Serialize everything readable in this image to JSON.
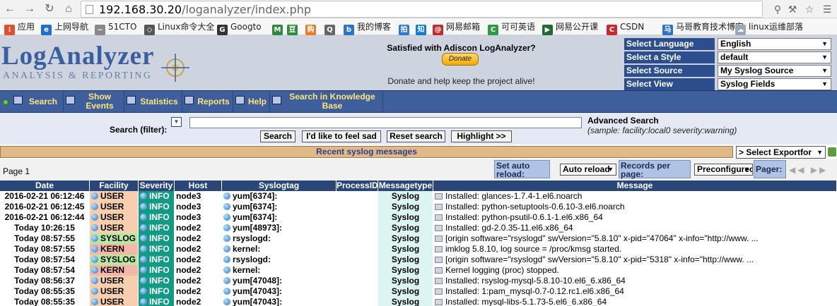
{
  "browser": {
    "url_host": "192.168.30.20",
    "url_path": "/loganalyzer/index.php",
    "bookmarks": [
      {
        "label": "应用",
        "icon": "apps-icon",
        "color": "#e0522b"
      },
      {
        "label": "上网导航",
        "icon": "ie-icon",
        "color": "#1e6fd0"
      },
      {
        "label": "51CTO",
        "icon": "51cto-icon",
        "color": "#888888"
      },
      {
        "label": "Linux命令大全",
        "icon": "linux-cmd-icon",
        "color": "#555555"
      },
      {
        "label": "Googto",
        "icon": "google-icon",
        "color": "#333333"
      },
      {
        "label": "",
        "icon": "m-icon",
        "color": "#2a8a3a"
      },
      {
        "label": "",
        "icon": "douban-icon",
        "color": "#2f8a3c"
      },
      {
        "label": "",
        "icon": "shopping-icon",
        "color": "#f07b1e"
      },
      {
        "label": "",
        "icon": "qq-icon",
        "color": "#666666"
      },
      {
        "label": "我的博客",
        "icon": "blog-icon",
        "color": "#2c73c9"
      },
      {
        "label": "",
        "icon": "photo-icon",
        "color": "#2f7ad1"
      },
      {
        "label": "",
        "icon": "zhihu-icon",
        "color": "#0f7ed9"
      },
      {
        "label": "网易邮箱",
        "icon": "mail-icon",
        "color": "#c62b2b"
      },
      {
        "label": "可可英语",
        "icon": "kekenet-icon",
        "color": "#2d9a42"
      },
      {
        "label": "网易公开课",
        "icon": "open-course-icon",
        "color": "#1f6b2f"
      },
      {
        "label": "CSDN",
        "icon": "csdn-icon",
        "color": "#c9282e"
      },
      {
        "label": "马哥教育技术博客",
        "icon": "magedu-icon",
        "color": "#2c73c9"
      },
      {
        "label": "linux运维部落",
        "icon": "linux-tribe-icon",
        "color": "#9aa7b6"
      }
    ]
  },
  "header": {
    "logo_title": "LogAnalyzer",
    "logo_subtitle": "ANALYSIS & REPORTING",
    "donate_heading": "Satisfied with Adiscon LogAnalyzer?",
    "donate_button": "Donate",
    "donate_note": "Donate and help keep the project alive!",
    "selectors": [
      {
        "label": "Select Language",
        "value": "English"
      },
      {
        "label": "Select a Style",
        "value": "default"
      },
      {
        "label": "Select Source",
        "value": "My Syslog Source"
      },
      {
        "label": "Select View",
        "value": "Syslog Fields"
      }
    ]
  },
  "menu": {
    "items": [
      {
        "label": "Search",
        "icon": "search-icon"
      },
      {
        "label": "Show Events",
        "icon": "events-icon"
      },
      {
        "label": "Statistics",
        "icon": "statistics-icon"
      },
      {
        "label": "Reports",
        "icon": "reports-icon"
      },
      {
        "label": "Help",
        "icon": "help-icon"
      },
      {
        "label": "Search in Knowledge Base",
        "icon": "knowledge-base-icon"
      }
    ]
  },
  "search": {
    "label": "Search (filter):",
    "value": "",
    "buttons": [
      "Search",
      "I'd like to feel sad",
      "Reset search",
      "Highlight >>"
    ],
    "advanced_label": "Advanced Search",
    "sample": "(sample: facility:local0 severity:warning)"
  },
  "recent": {
    "title": "Recent syslog messages",
    "export_select": "> Select Exportfor"
  },
  "pager": {
    "page_label": "Page 1",
    "autoreload_label": "Set auto reload:",
    "autoreload_value": "Auto reload",
    "records_label": "Records per page:",
    "records_value": "Preconfigured",
    "pager_label": "Pager:"
  },
  "table": {
    "columns": [
      "Date",
      "Facility",
      "Severity",
      "Host",
      "Syslogtag",
      "ProcessID",
      "Messagetype",
      "Message"
    ],
    "rows": [
      {
        "date": "2016-02-21 06:12:46",
        "facility": "USER",
        "fcolor": "#f7cfaf",
        "severity": "INFO",
        "host": "node3",
        "tag": "yum[6374]:",
        "pid": "",
        "mtype": "Syslog",
        "msg": "Installed: glances-1.7.4-1.el6.noarch"
      },
      {
        "date": "2016-02-21 06:12:45",
        "facility": "USER",
        "fcolor": "#f7cfaf",
        "severity": "INFO",
        "host": "node3",
        "tag": "yum[6374]:",
        "pid": "",
        "mtype": "Syslog",
        "msg": "Installed: python-setuptools-0.6.10-3.el6.noarch"
      },
      {
        "date": "2016-02-21 06:12:44",
        "facility": "USER",
        "fcolor": "#f7cfaf",
        "severity": "INFO",
        "host": "node3",
        "tag": "yum[6374]:",
        "pid": "",
        "mtype": "Syslog",
        "msg": "Installed: python-psutil-0.6.1-1.el6.x86_64"
      },
      {
        "date": "Today 10:26:15",
        "facility": "USER",
        "fcolor": "#f7cfaf",
        "severity": "INFO",
        "host": "node2",
        "tag": "yum[48973]:",
        "pid": "",
        "mtype": "Syslog",
        "msg": "Installed: gd-2.0.35-11.el6.x86_64"
      },
      {
        "date": "Today 08:57:55",
        "facility": "SYSLOG",
        "fcolor": "#b8e8a0",
        "severity": "INFO",
        "host": "node2",
        "tag": "rsyslogd:",
        "pid": "",
        "mtype": "Syslog",
        "msg": "[origin software=\"rsyslogd\" swVersion=\"5.8.10\" x-pid=\"47064\" x-info=\"http://www. ..."
      },
      {
        "date": "Today 08:57:55",
        "facility": "KERN",
        "fcolor": "#f4b7a8",
        "severity": "INFO",
        "host": "node2",
        "tag": "kernel:",
        "pid": "",
        "mtype": "Syslog",
        "msg": "imklog 5.8.10, log source = /proc/kmsg started."
      },
      {
        "date": "Today 08:57:54",
        "facility": "SYSLOG",
        "fcolor": "#b8e8a0",
        "severity": "INFO",
        "host": "node2",
        "tag": "rsyslogd:",
        "pid": "",
        "mtype": "Syslog",
        "msg": "[origin software=\"rsyslogd\" swVersion=\"5.8.10\" x-pid=\"5318\" x-info=\"http://www. ..."
      },
      {
        "date": "Today 08:57:54",
        "facility": "KERN",
        "fcolor": "#f4b7a8",
        "severity": "INFO",
        "host": "node2",
        "tag": "kernel:",
        "pid": "",
        "mtype": "Syslog",
        "msg": "Kernel logging (proc) stopped."
      },
      {
        "date": "Today 08:56:37",
        "facility": "USER",
        "fcolor": "#f7cfaf",
        "severity": "INFO",
        "host": "node2",
        "tag": "yum[47048]:",
        "pid": "",
        "mtype": "Syslog",
        "msg": "Installed: rsyslog-mysql-5.8.10-10.el6_6.x86_64"
      },
      {
        "date": "Today 08:55:35",
        "facility": "USER",
        "fcolor": "#f7cfaf",
        "severity": "INFO",
        "host": "node2",
        "tag": "yum[47043]:",
        "pid": "",
        "mtype": "Syslog",
        "msg": "Installed: 1:pam_mysql-0.7-0.12.rc1.el6.x86_64"
      },
      {
        "date": "Today 08:55:35",
        "facility": "USER",
        "fcolor": "#f7cfaf",
        "severity": "INFO",
        "host": "node2",
        "tag": "yum[47043]:",
        "pid": "",
        "mtype": "Syslog",
        "msg": "Installed: mysql-libs-5.1.73-5.el6_6.x86_64"
      }
    ]
  }
}
